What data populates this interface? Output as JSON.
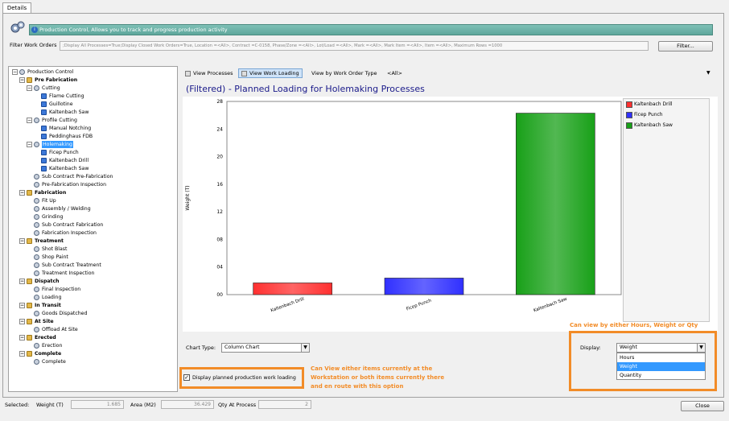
{
  "tabs": {
    "details": "Details"
  },
  "header": {
    "text": "Production Control, Allows you to track and progress production activity"
  },
  "filter": {
    "label": "Filter Work Orders",
    "value": ";Display All Processes=True;Display Closed Work Orders=True, Location =<All>, Contract =C-0158, Phase/Zone =<All>, Lot/Load =<All>, Mark =<All>, Mark Item =<All>, Item =<All>, Maximum Rows =1000",
    "button": "Filter..."
  },
  "tree": [
    {
      "label": "Production Control",
      "level": 0,
      "icon": "root",
      "expander": "-",
      "bold": false
    },
    {
      "label": "Pre Fabrication",
      "level": 1,
      "icon": "folder",
      "expander": "-",
      "bold": true
    },
    {
      "label": "Cutting",
      "level": 2,
      "icon": "gear",
      "expander": "-",
      "bold": false
    },
    {
      "label": "Flame Cutting",
      "level": 3,
      "icon": "station",
      "expander": "",
      "bold": false
    },
    {
      "label": "Guillotine",
      "level": 3,
      "icon": "station",
      "expander": "",
      "bold": false
    },
    {
      "label": "Kaltenbach Saw",
      "level": 3,
      "icon": "station",
      "expander": "",
      "bold": false
    },
    {
      "label": "Profile Cutting",
      "level": 2,
      "icon": "gear",
      "expander": "-",
      "bold": false
    },
    {
      "label": "Manual Notching",
      "level": 3,
      "icon": "station",
      "expander": "",
      "bold": false
    },
    {
      "label": "Peddinghaus FDB",
      "level": 3,
      "icon": "station",
      "expander": "",
      "bold": false
    },
    {
      "label": "Holemaking",
      "level": 2,
      "icon": "gear",
      "expander": "-",
      "bold": false,
      "selected": true
    },
    {
      "label": "Ficep Punch",
      "level": 3,
      "icon": "station",
      "expander": "",
      "bold": false
    },
    {
      "label": "Kaltenbach Drill",
      "level": 3,
      "icon": "station",
      "expander": "",
      "bold": false
    },
    {
      "label": "Kaltenbach Saw",
      "level": 3,
      "icon": "station",
      "expander": "",
      "bold": false
    },
    {
      "label": "Sub Contract Pre-Fabrication",
      "level": 2,
      "icon": "gear",
      "expander": "",
      "bold": false
    },
    {
      "label": "Pre-Fabrication Inspection",
      "level": 2,
      "icon": "gear",
      "expander": "",
      "bold": false
    },
    {
      "label": "Fabrication",
      "level": 1,
      "icon": "folder",
      "expander": "-",
      "bold": true
    },
    {
      "label": "Fit Up",
      "level": 2,
      "icon": "gear",
      "expander": "",
      "bold": false
    },
    {
      "label": "Assembly / Welding",
      "level": 2,
      "icon": "gear",
      "expander": "",
      "bold": false
    },
    {
      "label": "Grinding",
      "level": 2,
      "icon": "gear",
      "expander": "",
      "bold": false
    },
    {
      "label": "Sub Contract Fabrication",
      "level": 2,
      "icon": "gear",
      "expander": "",
      "bold": false
    },
    {
      "label": "Fabrication Inspection",
      "level": 2,
      "icon": "gear",
      "expander": "",
      "bold": false
    },
    {
      "label": "Treatment",
      "level": 1,
      "icon": "folder",
      "expander": "-",
      "bold": true
    },
    {
      "label": "Shot Blast",
      "level": 2,
      "icon": "gear",
      "expander": "",
      "bold": false
    },
    {
      "label": "Shop Paint",
      "level": 2,
      "icon": "gear",
      "expander": "",
      "bold": false
    },
    {
      "label": "Sub Contract Treatment",
      "level": 2,
      "icon": "gear",
      "expander": "",
      "bold": false
    },
    {
      "label": "Treatment Inspection",
      "level": 2,
      "icon": "gear",
      "expander": "",
      "bold": false
    },
    {
      "label": "Dispatch",
      "level": 1,
      "icon": "folder",
      "expander": "-",
      "bold": true
    },
    {
      "label": "Final Inspection",
      "level": 2,
      "icon": "gear",
      "expander": "",
      "bold": false
    },
    {
      "label": "Loading",
      "level": 2,
      "icon": "gear",
      "expander": "",
      "bold": false
    },
    {
      "label": "In Transit",
      "level": 1,
      "icon": "folder",
      "expander": "-",
      "bold": true
    },
    {
      "label": "Goods Dispatched",
      "level": 2,
      "icon": "gear",
      "expander": "",
      "bold": false
    },
    {
      "label": "At Site",
      "level": 1,
      "icon": "folder",
      "expander": "-",
      "bold": true
    },
    {
      "label": "Offload At Site",
      "level": 2,
      "icon": "gear",
      "expander": "",
      "bold": false
    },
    {
      "label": "Erected",
      "level": 1,
      "icon": "folder",
      "expander": "-",
      "bold": true
    },
    {
      "label": "Erection",
      "level": 2,
      "icon": "gear",
      "expander": "",
      "bold": false
    },
    {
      "label": "Complete",
      "level": 1,
      "icon": "folder",
      "expander": "-",
      "bold": true
    },
    {
      "label": "Complete",
      "level": 2,
      "icon": "gear",
      "expander": "",
      "bold": false
    }
  ],
  "view_tabs": [
    {
      "label": "View Processes",
      "active": false
    },
    {
      "label": "View Work Loading",
      "active": true
    },
    {
      "label": "View by Work Order Type",
      "active": false
    },
    {
      "label": "<All>",
      "active": false
    }
  ],
  "chart_data": {
    "type": "bar",
    "title": "(Filtered) - Planned Loading for Holemaking Processes",
    "ylabel": "Weight (T)",
    "xlabel": "",
    "categories": [
      "Kaltenbach Drill",
      "Ficep Punch",
      "Kaltenbach Saw"
    ],
    "values": [
      1.7,
      2.4,
      26.3
    ],
    "colors": [
      "#ff3030",
      "#3030ff",
      "#18a018"
    ],
    "ylim": [
      0,
      28
    ],
    "yticks": [
      "00",
      "04",
      "08",
      "12",
      "16",
      "20",
      "24",
      "28"
    ],
    "legend": [
      {
        "name": "Kaltenbach Drill",
        "color": "#ff3030"
      },
      {
        "name": "Ficep Punch",
        "color": "#3030ff"
      },
      {
        "name": "Kaltenbach Saw",
        "color": "#18a018"
      }
    ],
    "legend_position": "right"
  },
  "chart_type": {
    "label": "Chart Type:",
    "value": "Column Chart"
  },
  "display": {
    "label": "Display:",
    "value": "Weight",
    "options": [
      "Hours",
      "Weight",
      "Quantity"
    ],
    "selected": "Weight"
  },
  "checkbox": {
    "label": "Display planned production work loading",
    "checked": true
  },
  "annotations": {
    "display_note": "Can view by either Hours, Weight or Qty",
    "checkbox_note": "Can View either items currently at the Workstation or both items currently there and en route with this option"
  },
  "status": {
    "selected_label": "Selected:",
    "weight_label": "Weight (T)",
    "weight_value": "1.685",
    "area_label": "Area (M2)",
    "area_value": "36.429",
    "qty_label": "Qty At Process",
    "qty_value": "2"
  },
  "close_button": "Close"
}
